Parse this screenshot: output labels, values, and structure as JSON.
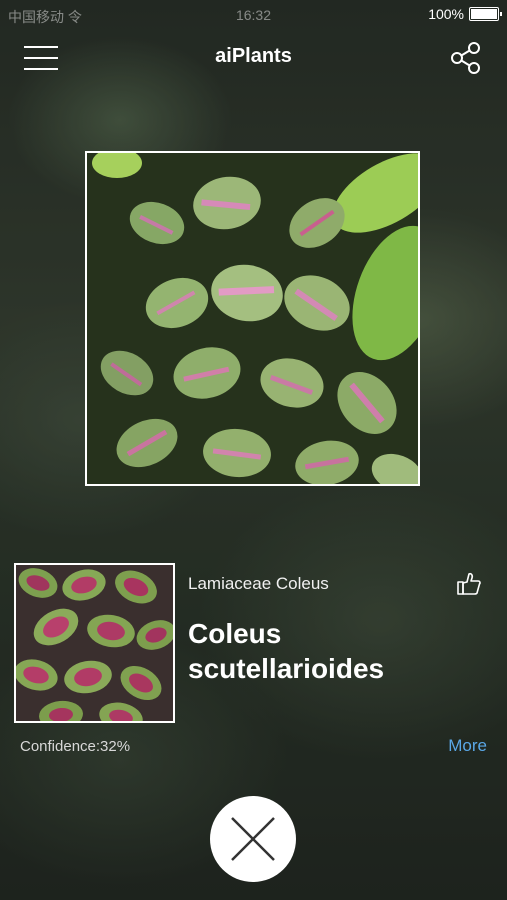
{
  "status_bar": {
    "carrier": "中国移动 令",
    "time": "16:32",
    "battery": "100%"
  },
  "header": {
    "title": "aiPlants"
  },
  "icons": {
    "menu": "hamburger-menu-icon",
    "share": "share-icon",
    "like": "thumbs-up-icon",
    "close": "close-x-icon"
  },
  "result": {
    "family": "Lamiaceae Coleus",
    "species": "Coleus scutellarioides",
    "confidence": "Confidence:32%",
    "more_label": "More"
  },
  "colors": {
    "accent": "#5aa7e6",
    "leaf_green": "#8fb86a",
    "leaf_pink": "#c98aa4"
  }
}
